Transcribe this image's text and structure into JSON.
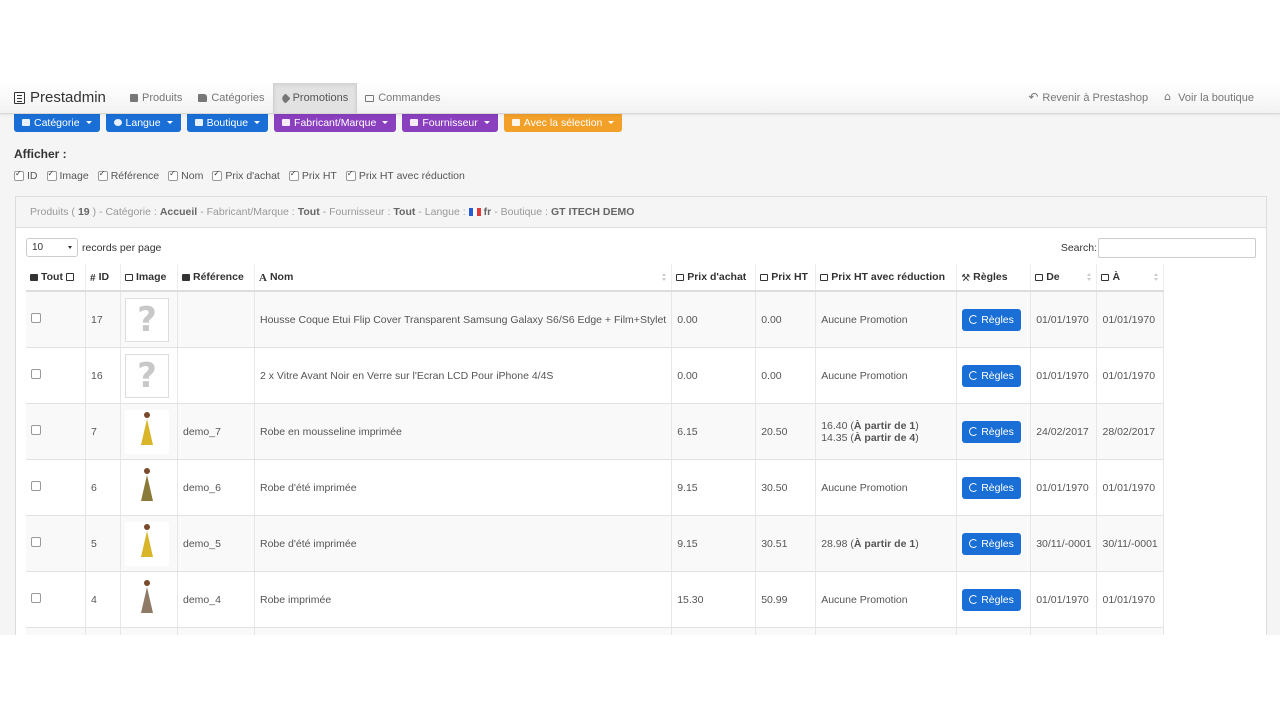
{
  "navbar": {
    "brand": "Prestadmin",
    "items": [
      {
        "label": "Produits",
        "icon": "book-icon",
        "active": false
      },
      {
        "label": "Catégories",
        "icon": "folder-icon",
        "active": false
      },
      {
        "label": "Promotions",
        "icon": "tag-icon",
        "active": true
      },
      {
        "label": "Commandes",
        "icon": "credit-card-icon",
        "active": false
      }
    ],
    "right": [
      {
        "label": "Revenir à Prestashop",
        "icon": "back-arrow-icon"
      },
      {
        "label": "Voir la boutique",
        "icon": "home-icon"
      }
    ]
  },
  "filters": [
    {
      "label": "Catégorie",
      "color": "#1a6fd6",
      "icon": "folder-open-icon"
    },
    {
      "label": "Langue",
      "color": "#1a6fd6",
      "icon": "globe-icon"
    },
    {
      "label": "Boutique",
      "color": "#1a6fd6",
      "icon": "cart-icon"
    },
    {
      "label": "Fabricant/Marque",
      "color": "#8a3fbf",
      "icon": "cogs-icon"
    },
    {
      "label": "Fournisseur",
      "color": "#8a3fbf",
      "icon": "truck-icon"
    },
    {
      "label": "Avec la sélection",
      "color": "#f3a028",
      "icon": "check-square-icon"
    }
  ],
  "show": {
    "title": "Afficher :",
    "columns": [
      "ID",
      "Image",
      "Référence",
      "Nom",
      "Prix d'achat",
      "Prix HT",
      "Prix HT avec réduction"
    ]
  },
  "panel": {
    "products_label": "Produits (",
    "products_count": "19",
    "products_close": ") - Catégorie :",
    "category": "Accueil",
    "manufacturer_label": "- Fabricant/Marque :",
    "manufacturer": "Tout",
    "supplier_label": "- Fournisseur :",
    "supplier": "Tout",
    "language_label": "- Langue :",
    "language": "fr",
    "shop_label": "- Boutique :",
    "shop": "GT ITECH DEMO"
  },
  "table_controls": {
    "page_length": "10",
    "page_length_label": "records per page",
    "search_label": "Search:"
  },
  "columns": [
    "Tout",
    "ID",
    "Image",
    "Référence",
    "Nom",
    "Prix d'achat",
    "Prix HT",
    "Prix HT avec réduction",
    "Règles",
    "De",
    "À"
  ],
  "rows": [
    {
      "id": "17",
      "image": "placeholder",
      "reference": "",
      "name": "Housse Coque Etui Flip Cover Transparent Samsung Galaxy S6/S6 Edge + Film+Stylet",
      "purchase": "0.00",
      "price": "0.00",
      "reduction": [
        {
          "text": "Aucune Promotion"
        }
      ],
      "rules": "Règles",
      "from": "01/01/1970",
      "to": "01/01/1970"
    },
    {
      "id": "16",
      "image": "placeholder",
      "reference": "",
      "name": "2 x Vitre Avant Noir en Verre sur l'Ecran LCD Pour iPhone 4/4S",
      "purchase": "0.00",
      "price": "0.00",
      "reduction": [
        {
          "text": "Aucune Promotion"
        }
      ],
      "rules": "Règles",
      "from": "01/01/1970",
      "to": "01/01/1970"
    },
    {
      "id": "7",
      "image": "dress-yellow",
      "reference": "demo_7",
      "name": "Robe en mousseline imprimée",
      "purchase": "6.15",
      "price": "20.50",
      "reduction": [
        {
          "value": "16.40",
          "qty": "À partir de 1"
        },
        {
          "value": "14.35",
          "qty": "À partir de 4"
        }
      ],
      "rules": "Règles",
      "from": "24/02/2017",
      "to": "28/02/2017"
    },
    {
      "id": "6",
      "image": "dress-olive",
      "reference": "demo_6",
      "name": "Robe d'été imprimée",
      "purchase": "9.15",
      "price": "30.50",
      "reduction": [
        {
          "text": "Aucune Promotion"
        }
      ],
      "rules": "Règles",
      "from": "01/01/1970",
      "to": "01/01/1970"
    },
    {
      "id": "5",
      "image": "dress-yellow",
      "reference": "demo_5",
      "name": "Robe d'été imprimée",
      "purchase": "9.15",
      "price": "30.51",
      "reduction": [
        {
          "value": "28.98",
          "qty": "À partir de 1"
        }
      ],
      "rules": "Règles",
      "from": "30/11/-0001",
      "to": "30/11/-0001"
    },
    {
      "id": "4",
      "image": "dress-print",
      "reference": "demo_4",
      "name": "Robe imprimée",
      "purchase": "15.30",
      "price": "50.99",
      "reduction": [
        {
          "text": "Aucune Promotion"
        }
      ],
      "rules": "Règles",
      "from": "01/01/1970",
      "to": "01/01/1970"
    }
  ]
}
